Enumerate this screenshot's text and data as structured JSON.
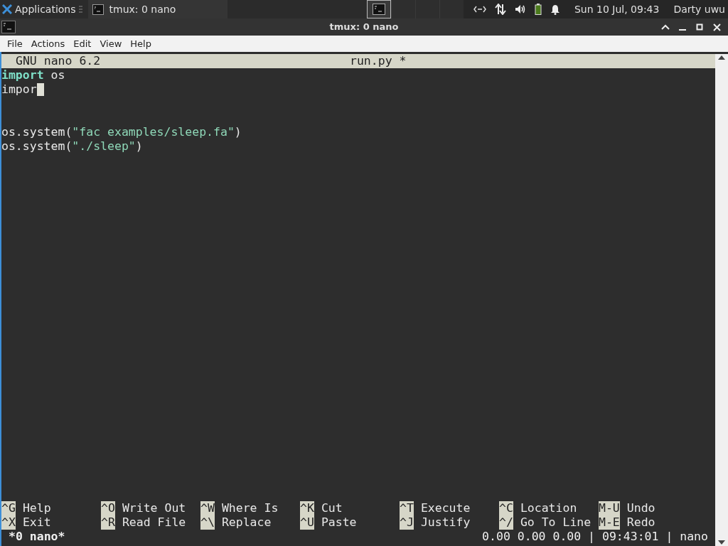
{
  "panel": {
    "app_menu": "Applications",
    "tasks": [
      {
        "label": "tmux: 0 nano",
        "selected": false
      }
    ],
    "workspaces": [
      {
        "selected": true
      },
      {
        "selected": false
      },
      {
        "selected": false
      },
      {
        "selected": false
      }
    ],
    "clock": "Sun 10 Jul, 09:43",
    "user": "Darty uwu"
  },
  "window": {
    "title": "tmux: 0 nano"
  },
  "menu": [
    "File",
    "Actions",
    "Edit",
    "View",
    "Help"
  ],
  "nano": {
    "version": "GNU nano 6.2",
    "filename": "run.py *",
    "lines": [
      {
        "kind": "code",
        "tokens": [
          {
            "kind": "keyword",
            "text": "import"
          },
          {
            "kind": "plain",
            "text": " os"
          }
        ]
      },
      {
        "kind": "code",
        "cursor": true,
        "tokens": [
          {
            "kind": "plain",
            "text": "impor"
          }
        ]
      },
      {
        "kind": "blank"
      },
      {
        "kind": "blank"
      },
      {
        "kind": "code",
        "tokens": [
          {
            "kind": "plain",
            "text": "os.system("
          },
          {
            "kind": "string",
            "text": "\"fac examples/sleep.fa\""
          },
          {
            "kind": "plain",
            "text": ")"
          }
        ]
      },
      {
        "kind": "code",
        "tokens": [
          {
            "kind": "plain",
            "text": "os.system("
          },
          {
            "kind": "string",
            "text": "\"./sleep\""
          },
          {
            "kind": "plain",
            "text": ")"
          }
        ]
      }
    ],
    "shortcuts": [
      [
        {
          "key": "^G",
          "label": "Help"
        },
        {
          "key": "^X",
          "label": "Exit"
        }
      ],
      [
        {
          "key": "^O",
          "label": "Write Out"
        },
        {
          "key": "^R",
          "label": "Read File"
        }
      ],
      [
        {
          "key": "^W",
          "label": "Where Is"
        },
        {
          "key": "^\\",
          "label": "Replace"
        }
      ],
      [
        {
          "key": "^K",
          "label": "Cut"
        },
        {
          "key": "^U",
          "label": "Paste"
        }
      ],
      [
        {
          "key": "^T",
          "label": "Execute"
        },
        {
          "key": "^J",
          "label": "Justify"
        }
      ],
      [
        {
          "key": "^C",
          "label": "Location"
        },
        {
          "key": "^/",
          "label": "Go To Line"
        }
      ],
      [
        {
          "key": "M-U",
          "label": "Undo"
        },
        {
          "key": "M-E",
          "label": "Redo"
        }
      ]
    ]
  },
  "tmux_status": {
    "left": "*0 nano*",
    "right": "0.00 0.00 0.00 | 09:43:01 | nano"
  }
}
